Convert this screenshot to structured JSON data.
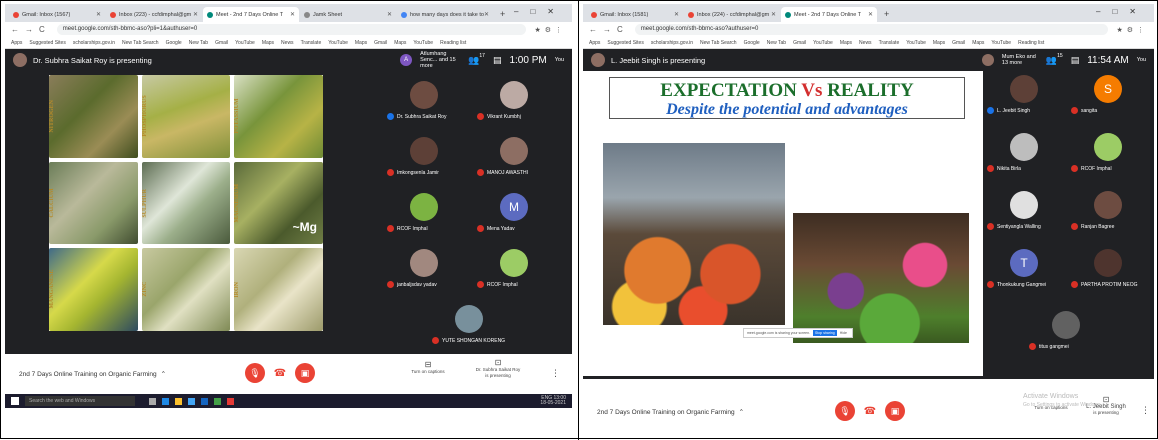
{
  "left": {
    "tabs": [
      {
        "label": "Gmail: Inbox (1567)",
        "color": "#ea4335"
      },
      {
        "label": "Inbox (223) - ccfdimphal@gm",
        "color": "#ea4335"
      },
      {
        "label": "Meet - 2nd 7 Days Online T",
        "color": "#00897b"
      },
      {
        "label": "Jamk Sheet",
        "color": "#888888"
      },
      {
        "label": "how many days does it take to",
        "color": "#4285f4"
      }
    ],
    "url": "meet.google.com/sth-bbmc-aso?pli=1&authuser=0",
    "bookmarks": [
      "Apps",
      "Suggested Sites",
      "scholarships.gov.in",
      "New Tab Search",
      "Google",
      "New Tab",
      "Gmail",
      "YouTube",
      "Maps",
      "News",
      "Translate",
      "YouTube",
      "Maps",
      "Gmail",
      "Maps",
      "YouTube",
      "Reading list"
    ],
    "presenting": "Dr. Subhra Saikat Roy is presenting",
    "participants_summary": "Atlumhang Senc... and 15 more",
    "participant_count": "17",
    "time": "1:00 PM",
    "you_label": "You",
    "nutrients": [
      "NITROGEN",
      "PHOSPHORUS",
      "POTASSIUM",
      "CALCIUM",
      "SULPHUR",
      "MAGNESIUM",
      "MANGANESE",
      "ZINC",
      "IRON"
    ],
    "mg_label": "~Mg",
    "participants": [
      {
        "name": "Dr. Subhra Saikat Roy",
        "initial": ""
      },
      {
        "name": "Vikrant Kumbhj",
        "initial": ""
      },
      {
        "name": "Imkongsenla Jamir",
        "initial": ""
      },
      {
        "name": "MANOJ AWASTHI",
        "initial": ""
      },
      {
        "name": "RCOF Imphal",
        "initial": ""
      },
      {
        "name": "Mena Yadav",
        "initial": "M"
      },
      {
        "name": "janbaljsdav yadav",
        "initial": ""
      },
      {
        "name": "RCOF Imphal",
        "initial": ""
      },
      {
        "name": "YUTE SHONGAN KORENG",
        "initial": ""
      }
    ],
    "meeting_title": "2nd 7 Days Online Training on Organic Farming",
    "captions_label": "Turn on captions",
    "presenter_caption": "Dr. Subhra Saikat Roy is presenting",
    "taskbar_search": "Search the web and Windows",
    "tray_time": "13:00",
    "tray_date": "18-05-2021",
    "tray_lang": "ENG"
  },
  "right": {
    "tabs": [
      {
        "label": "Gmail: Inbox (1581)",
        "color": "#ea4335"
      },
      {
        "label": "Inbox (224) - ccfdimphal@gm",
        "color": "#ea4335"
      },
      {
        "label": "Meet - 2nd 7 Days Online T",
        "color": "#00897b"
      }
    ],
    "url": "meet.google.com/sth-bbmc-aso?authuser=0",
    "bookmarks": [
      "Apps",
      "Suggested Sites",
      "scholarships.gov.in",
      "New Tab Search",
      "Google",
      "New Tab",
      "Gmail",
      "YouTube",
      "Maps",
      "News",
      "Translate",
      "YouTube",
      "Maps",
      "Gmail",
      "Maps",
      "YouTube",
      "Reading list"
    ],
    "presenting": "L. Jeebit Singh is presenting",
    "participants_summary": "Mum Eko and 13 more",
    "participant_count": "15",
    "time": "11:54 AM",
    "you_label": "You",
    "slide_title_a": "EXPECTATION ",
    "slide_title_vs": "Vs",
    "slide_title_b": " REALITY",
    "slide_subtitle": "Despite the potential and advantages",
    "popup_text": "meet.google.com is sharing your screen.",
    "popup_stop": "Stop sharing",
    "popup_hide": "Hide",
    "participants": [
      {
        "name": "L. Jeebit Singh",
        "initial": ""
      },
      {
        "name": "sangita",
        "initial": "S"
      },
      {
        "name": "Nikita Birla",
        "initial": ""
      },
      {
        "name": "RCOF Imphal",
        "initial": ""
      },
      {
        "name": "Sentiyangla Walling",
        "initial": ""
      },
      {
        "name": "Ranjan Bagree",
        "initial": ""
      },
      {
        "name": "Thonkukung Gangmei",
        "initial": "T"
      },
      {
        "name": "PARTHA PROTIM NEOG",
        "initial": ""
      },
      {
        "name": "titus gangmei",
        "initial": ""
      }
    ],
    "meeting_title": "2nd 7 Days Online Training on Organic Farming",
    "captions_label": "Turn on captions",
    "presenter_caption_name": "L. Jeebit Singh",
    "presenter_caption_rest": "is presenting",
    "activate_1": "Activate Windows",
    "activate_2": "Go to Settings to activate Windows."
  }
}
